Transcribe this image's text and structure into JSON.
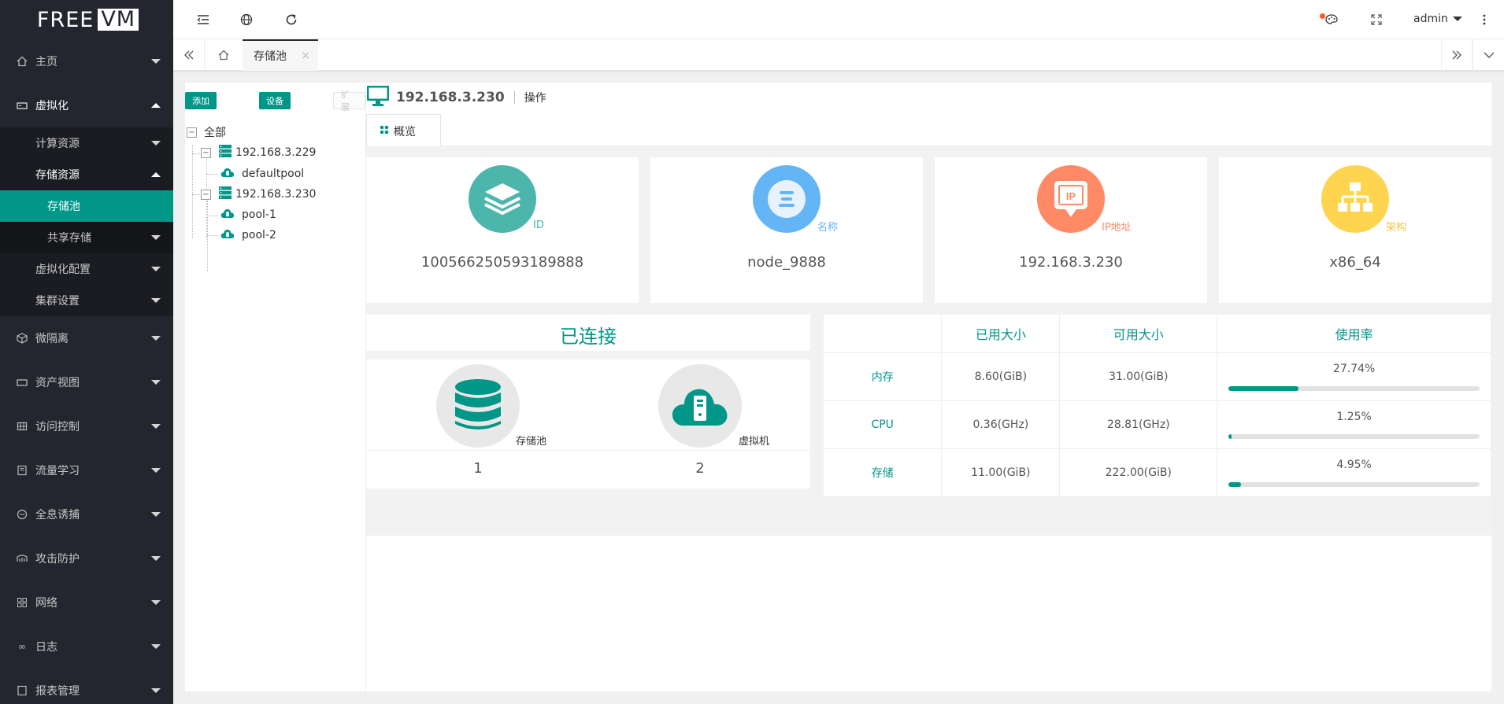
{
  "logo": {
    "part1": "FREE",
    "part2": "VM"
  },
  "sidebar": {
    "items": [
      {
        "label": "主页"
      },
      {
        "label": "虚拟化"
      },
      {
        "label": "微隔离"
      },
      {
        "label": "资产视图"
      },
      {
        "label": "访问控制"
      },
      {
        "label": "流量学习"
      },
      {
        "label": "全息诱捕"
      },
      {
        "label": "攻击防护"
      },
      {
        "label": "网络"
      },
      {
        "label": "日志"
      },
      {
        "label": "报表管理"
      }
    ],
    "virt_sub": {
      "compute": "计算资源",
      "storage": "存储资源",
      "storage_pool": "存储池",
      "shared_storage": "共享存储",
      "virt_config": "虚拟化配置",
      "cluster": "集群设置"
    }
  },
  "topbar": {
    "user": "admin"
  },
  "tabs": {
    "active": "存储池",
    "close": "×"
  },
  "tree": {
    "buttons": {
      "add": "添加",
      "settings": "设备",
      "expand": "扩展"
    },
    "root": "全部",
    "hosts": [
      {
        "ip": "192.168.3.229",
        "pools": [
          "defaultpool"
        ]
      },
      {
        "ip": "192.168.3.230",
        "pools": [
          "pool-1",
          "pool-2"
        ]
      }
    ]
  },
  "host": {
    "ip": "192.168.3.230",
    "op_label": "操作",
    "overview_tab": "概览"
  },
  "cards": [
    {
      "label": "ID",
      "value": "100566250593189888",
      "color": "#4db6ac"
    },
    {
      "label": "名称",
      "value": "node_9888",
      "color": "#64b5f6"
    },
    {
      "label": "IP地址",
      "value": "192.168.3.230",
      "color": "#ff8a65",
      "badge": "IP"
    },
    {
      "label": "架构",
      "value": "x86_64",
      "color": "#ffd54f"
    }
  ],
  "connection": {
    "title": "已连接",
    "storage_label": "存储池",
    "storage_count": "1",
    "vm_label": "虚拟机",
    "vm_count": "2"
  },
  "resources": {
    "headers": [
      "",
      "已用大小",
      "可用大小",
      "使用率"
    ],
    "rows": [
      {
        "name": "内存",
        "used": "8.60(GiB)",
        "free": "31.00(GiB)",
        "pct_label": "27.74%",
        "pct": 27.74
      },
      {
        "name": "CPU",
        "used": "0.36(GHz)",
        "free": "28.81(GHz)",
        "pct_label": "1.25%",
        "pct": 1.25
      },
      {
        "name": "存储",
        "used": "11.00(GiB)",
        "free": "222.00(GiB)",
        "pct_label": "4.95%",
        "pct": 4.95
      }
    ]
  },
  "colors": {
    "accent": "#009688",
    "sidebar_bg": "#23262e"
  }
}
